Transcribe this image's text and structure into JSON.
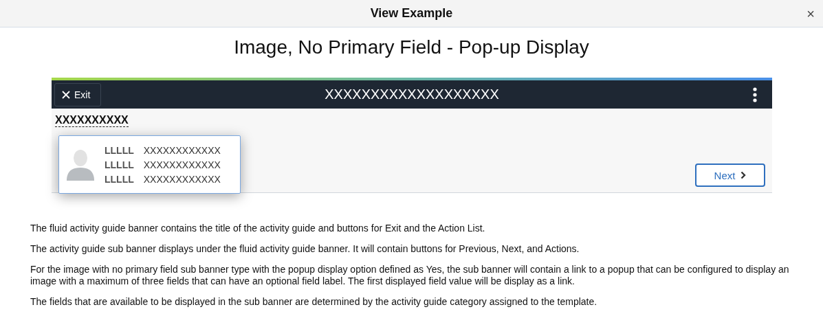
{
  "dialog": {
    "title": "View Example",
    "close": "×"
  },
  "heading": "Image, No Primary Field - Pop-up Display",
  "example": {
    "exit": "Exit",
    "banner_title": "XXXXXXXXXXXXXXXXXXX",
    "link": "XXXXXXXXXX",
    "next": "Next",
    "popup": {
      "fields": [
        {
          "label": "LLLLL",
          "value": "XXXXXXXXXXXX"
        },
        {
          "label": "LLLLL",
          "value": "XXXXXXXXXXXX"
        },
        {
          "label": "LLLLL",
          "value": "XXXXXXXXXXXX"
        }
      ]
    }
  },
  "paragraphs": [
    "The fluid activity guide banner contains the title of the activity guide and buttons for Exit and the Action List.",
    "The activity guide sub banner displays under the fluid activity guide banner.  It will contain buttons for Previous, Next, and Actions.",
    "For the image with no primary field sub banner type with the popup display option defined as Yes, the sub banner will contain a link to a popup that can be configured to display an image with a maximum of three fields that can have an optional field label.  The first displayed field value will be display as a link.",
    "The fields that are available to be displayed in the sub banner are determined by the activity guide category assigned to the template."
  ]
}
